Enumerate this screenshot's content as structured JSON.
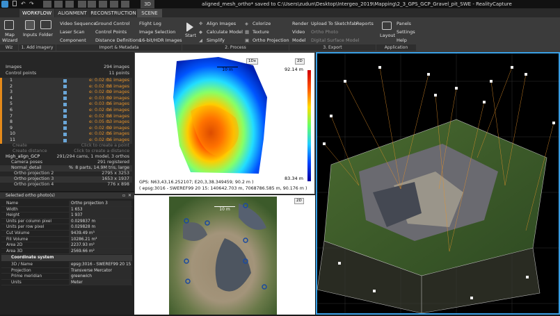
{
  "titlebar": {
    "text": "aligned_mesh_ortho* saved to C:\\Users\\zudun\\Desktop\\Intergeo_2019\\Mapping\\2_3_GPS_GCP_Gravel_pit_SWE - RealityCapture",
    "mode_3d": "3D"
  },
  "tabs": [
    {
      "label": "WORKFLOW"
    },
    {
      "label": "ALIGNMENT"
    },
    {
      "label": "RECONSTRUCTION"
    },
    {
      "label": "SCENE"
    }
  ],
  "ribbon": {
    "wiz": {
      "map_wizard": "Map Wizard",
      "section": "Wiz"
    },
    "add_imagery": {
      "inputs": "Inputs",
      "folder": "Folder",
      "section": "1. Add imagery"
    },
    "import_col1": [
      "Video Sequence",
      "Laser Scan",
      "Component"
    ],
    "import_col2": [
      "Ground Control",
      "Control Points",
      "Distance Definitions"
    ],
    "import_col3": [
      "Flight Log",
      "Image Selection",
      "16-bit/HDR Images"
    ],
    "import_section": "Import & Metadata",
    "process": {
      "start": "Start",
      "align": "Align Images",
      "calculate": "Calculate Model",
      "simplify": "Simplify",
      "colorize": "Colorize",
      "texture": "Texture",
      "ortho": "Ortho Projection",
      "section": "2. Process"
    },
    "export": {
      "render": "Render",
      "video": "Video",
      "model": "Model",
      "upload": "Upload To Sketchfab",
      "ortho_photo": "Ortho Photo",
      "dsm": "Digital Surface Model",
      "reports": "Reports",
      "section": "3. Export"
    },
    "application": {
      "layout": "Layout",
      "panels": "Panels",
      "settings": "Settings",
      "help": "Help",
      "section": "Application"
    }
  },
  "tree": {
    "images": {
      "label": "Images",
      "value": "294 images"
    },
    "control_points": {
      "label": "Control points",
      "value": "11 points"
    },
    "points": [
      {
        "id": "1",
        "error": "e: 0.02 m",
        "images": "11 images"
      },
      {
        "id": "2",
        "error": "e: 0.02 m",
        "images": "18 images"
      },
      {
        "id": "3",
        "error": "e: 0.02 m",
        "images": "19 images"
      },
      {
        "id": "4",
        "error": "e: 0.03 m",
        "images": "19 images"
      },
      {
        "id": "5",
        "error": "e: 0.03 m",
        "images": "16 images"
      },
      {
        "id": "6",
        "error": "e: 0.02 m",
        "images": "16 images"
      },
      {
        "id": "7",
        "error": "e: 0.02 m",
        "images": "18 images"
      },
      {
        "id": "8",
        "error": "e: 0.05 m",
        "images": "13 images"
      },
      {
        "id": "9",
        "error": "e: 0.02 m",
        "images": "19 images"
      },
      {
        "id": "10",
        "error": "e: 0.02 m",
        "images": "16 images"
      },
      {
        "id": "11",
        "error": "e: 0.02 m",
        "images": "16 images"
      }
    ],
    "create": "Create",
    "create_distance": "Create distance",
    "click_create_point": "Click to create a point",
    "click_create_distance": "Click to create a distance",
    "component": {
      "label": "High_align_GCP",
      "value": "291/294 cams, 1 model, 3 orthos"
    },
    "camera_poses": {
      "label": "Camera poses",
      "value": "291 registered"
    },
    "model": {
      "label": "Normal_detail",
      "pct": "%",
      "value": "8 parts, 14.9M tris, large"
    },
    "orthos": [
      {
        "label": "Ortho projection 2",
        "value": "2795 x 3253"
      },
      {
        "label": "Ortho projection 3",
        "value": "1653 x 1937"
      },
      {
        "label": "Ortho projection 4",
        "value": "776 x 898"
      }
    ]
  },
  "props": {
    "title": "Selected ortho photo(s)",
    "rows": [
      {
        "k": "Name",
        "v": "Ortho projection 3"
      },
      {
        "k": "Width",
        "v": "1 653"
      },
      {
        "k": "Height",
        "v": "1 937"
      },
      {
        "k": "Units per column pixel",
        "v": "0.029837 m"
      },
      {
        "k": "Units per row pixel",
        "v": "0.029828 m"
      },
      {
        "k": "Cut Volume",
        "v": "9439.49 m³"
      },
      {
        "k": "Fill Volume",
        "v": "10286.21 m³"
      },
      {
        "k": "Area 2D",
        "v": "2237.93 m²"
      },
      {
        "k": "Area 3D",
        "v": "2569.66 m²"
      }
    ],
    "coord_header": "Coordinate system",
    "coord_rows": [
      {
        "k": "3D / Name",
        "v": "epsg:3016 - SWEREF99 20 15"
      },
      {
        "k": "Projection",
        "v": "Transverse Mercator"
      },
      {
        "k": "Prime meridian",
        "v": "greenwich"
      },
      {
        "k": "Units",
        "v": "Meter"
      }
    ]
  },
  "view2d": {
    "badge_top": "1Dx",
    "badge": "2D",
    "scale": "10 m",
    "max": "92.14 m",
    "min": "83.34 m",
    "gps": "GPS: N63,43,16.252107; E20,3,38.349459; 90.2 m )",
    "epsg": "( epsg:3016 - SWEREF99 20 15: 140642.703 m, 7068786.585 m, 90.176 m )"
  },
  "ortho": {
    "badge": "2D",
    "scale": "10 m"
  },
  "colors": {
    "accent": "#3aa0e6",
    "orange": "#e5922a",
    "ribbon": "#3b3b3b"
  }
}
